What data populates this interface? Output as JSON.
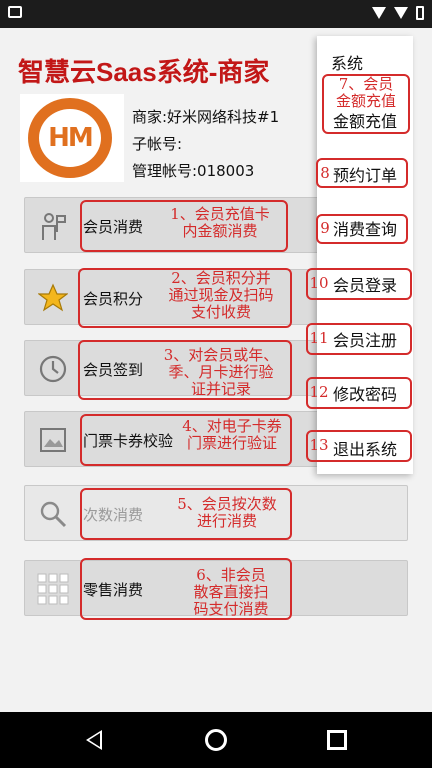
{
  "status": {
    "icons": [
      "notification-icon",
      "wifi-icon",
      "signal-icon",
      "battery-icon"
    ]
  },
  "app": {
    "title": "智慧云Saas系统-商家",
    "logo_text": "HM"
  },
  "merchant": {
    "name": "商家:好米网络科技#1",
    "sub_account": "子帐号:",
    "admin_account": "管理帐号:018003"
  },
  "menu": [
    {
      "label": "会员消费",
      "icon": "member-icon",
      "enabled": true
    },
    {
      "label": "会员积分",
      "icon": "star-icon",
      "enabled": true
    },
    {
      "label": "会员签到",
      "icon": "clock-icon",
      "enabled": true
    },
    {
      "label": "门票卡券校验",
      "icon": "image-icon",
      "enabled": true
    },
    {
      "label": "次数消费",
      "icon": "search-icon",
      "enabled": false
    },
    {
      "label": "零售消费",
      "icon": "grid-icon",
      "enabled": true
    }
  ],
  "dropdown": {
    "header": "系统",
    "items": [
      "金额充值",
      "预约订单",
      "消费查询",
      "会员登录",
      "会员注册",
      "修改密码",
      "退出系统"
    ]
  },
  "annotations": {
    "a1": "1、会员充值卡\n内金额消费",
    "a2": "2、会员积分并\n通过现金及扫码\n支付收费",
    "a3": "3、对会员或年、\n季、月卡进行验\n证并记录",
    "a4": "4、对电子卡券\n门票进行验证",
    "a5": "5、会员按次数\n进行消费",
    "a6": "6、非会员\n散客直接扫\n码支付消费",
    "a7": "7、会员\n金额充值",
    "n8": "8",
    "n9": "9",
    "n10": "10",
    "n11": "11",
    "n12": "12",
    "n13": "13"
  },
  "colors": {
    "title": "#c21717",
    "annotation": "#d42b2b",
    "logo": "#e0701f"
  }
}
